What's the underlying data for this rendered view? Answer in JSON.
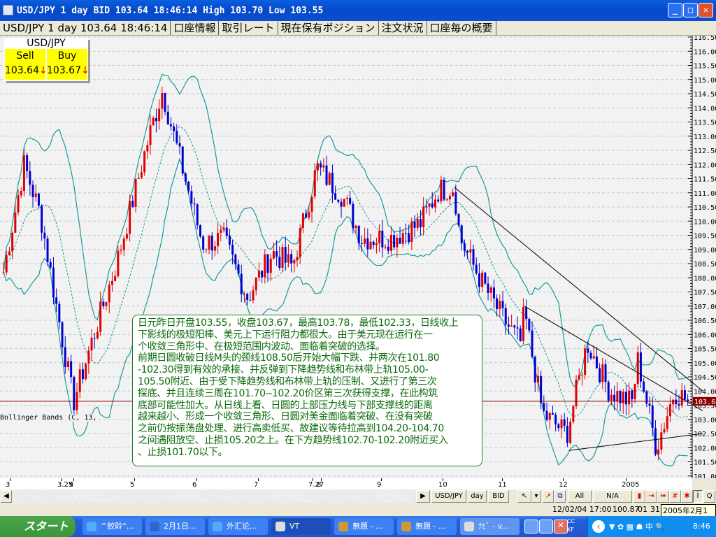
{
  "window": {
    "title": "USD/JPY 1 day BID 103.64 18:46:14 High 103.70 Low 103.55"
  },
  "tabs": [
    "USD/JPY 1 day 103.64 18:46:14",
    "口座情報",
    "取引レート",
    "現在保有ポジション",
    "注文状況",
    "口座毎の概要"
  ],
  "quote": {
    "symbol": "USD/JPY",
    "sell_label": "Sell",
    "buy_label": "Buy",
    "sell": "103.64",
    "buy": "103.67",
    "sell_arrow": "↓",
    "buy_arrow": "↓"
  },
  "indicator_label": "Bollinger Bands (C, 13,",
  "note_lines": [
    "日元昨日开盘103.55，收盘103.67，最高103.78，最低102.33，日线收上",
    "下影线的极短阳棒、美元上下运行阻力都很大。由于美元现在运行在一",
    "个收敛三角形中、在极短范围内波动、面临着突破的选择。",
    "前期日圆收破日线M头的颈线108.50后开始大幅下跌、并两次在101.80",
    "-102.30得到有效的承接、并反弹到下降趋势线和布林带上轨105.00-",
    "105.50附近、由于受下降趋势线和布林带上轨的压制、又进行了第三次",
    "探底、并且连续三周在101.70--102.20价区第三次获得支撑，在此构筑",
    "底部可能性加大。从日线上看、日圆的上部压力线与下部支撑线的距离",
    "越来越小、形成一个收敛三角形、日圆对美金面临着突破、在没有突破",
    "之前仍按振荡盘处理、进行高卖低买、故建议等待拉高到104.20-104.70",
    "之间遇阻放空、止损105.20之上。在下方趋势线102.70-102.20附近买入",
    "、止损101.70以下。"
  ],
  "chart_data": {
    "type": "candlestick",
    "symbol": "USD/JPY",
    "timeframe": "1 day",
    "ylim": [
      101.0,
      116.5
    ],
    "y_ticks": [
      "116.50",
      "116.00",
      "115.50",
      "115.00",
      "114.50",
      "114.00",
      "113.50",
      "113.00",
      "112.50",
      "112.00",
      "111.50",
      "111.00",
      "110.50",
      "110.00",
      "109.50",
      "109.00",
      "108.50",
      "108.00",
      "107.50",
      "107.00",
      "106.50",
      "106.00",
      "105.50",
      "105.00",
      "104.50",
      "104.00",
      "103.50",
      "103.00",
      "102.50",
      "102.00",
      "101.50",
      "101.00"
    ],
    "x_ticks": [
      "3",
      "3.25",
      "4",
      "5",
      "6",
      "7",
      "7.27",
      "8",
      "9",
      "10",
      "11",
      "12",
      "2005"
    ],
    "current_price": "103.64",
    "grid": true,
    "price_path": [
      [
        "2004-02-17",
        108.2
      ],
      [
        "2004-03-08",
        112.0
      ],
      [
        "2004-03-16",
        110.2
      ],
      [
        "2004-04-01",
        103.6
      ],
      [
        "2004-04-09",
        105.5
      ],
      [
        "2004-04-23",
        108.7
      ],
      [
        "2004-05-08",
        112.9
      ],
      [
        "2004-05-15",
        114.6
      ],
      [
        "2004-05-23",
        112.4
      ],
      [
        "2004-06-04",
        109.2
      ],
      [
        "2004-06-14",
        109.4
      ],
      [
        "2004-06-26",
        107.3
      ],
      [
        "2004-07-08",
        108.9
      ],
      [
        "2004-07-18",
        108.4
      ],
      [
        "2004-07-30",
        111.9
      ],
      [
        "2004-08-12",
        110.9
      ],
      [
        "2004-08-22",
        109.4
      ],
      [
        "2004-09-06",
        109.4
      ],
      [
        "2004-09-20",
        109.9
      ],
      [
        "2004-09-29",
        111.1
      ],
      [
        "2004-10-07",
        111.2
      ],
      [
        "2004-10-10",
        109.4
      ],
      [
        "2004-10-21",
        107.9
      ],
      [
        "2004-11-02",
        106.5
      ],
      [
        "2004-11-10",
        105.7
      ],
      [
        "2004-11-12",
        106.8
      ],
      [
        "2004-11-21",
        103.2
      ],
      [
        "2004-12-03",
        102.5
      ],
      [
        "2004-12-13",
        105.7
      ],
      [
        "2004-12-24",
        104.0
      ],
      [
        "2005-01-04",
        103.6
      ],
      [
        "2005-01-07",
        105.1
      ],
      [
        "2005-01-16",
        102.0
      ],
      [
        "2005-01-25",
        104.0
      ],
      [
        "2005-02-01",
        103.64
      ]
    ],
    "bollinger": {
      "period": 13,
      "deviations": 2
    },
    "trendlines": [
      {
        "from": [
          "2004-10-07",
          111.2
        ],
        "to": [
          "2005-02-08",
          104.0
        ]
      },
      {
        "from": [
          "2004-11-12",
          107.0
        ],
        "to": [
          "2005-02-08",
          103.3
        ]
      },
      {
        "from": [
          "2004-12-04",
          101.9
        ],
        "to": [
          "2005-02-08",
          102.5
        ]
      }
    ]
  },
  "toolbar": {
    "symbol": "USD/JPY",
    "period": "day",
    "price_type": "BID",
    "all": "All",
    "na": "N/A",
    "q": "Q"
  },
  "status": {
    "datetime": "12/02/04 17:00",
    "price": "100.87",
    "field1": "01",
    "field2": "31",
    "date": "2005年2月1日"
  },
  "taskbar": {
    "start": "スタート",
    "items": [
      "^餃聆°...",
      "2月1日...",
      "外汇论...",
      "VT",
      "無題 - ...",
      "無題 - ...",
      "ﾅﾋﾞ - v..."
    ],
    "tray_cc": "CC",
    "tray_kf": "KF",
    "clock": "8:46"
  },
  "colors": {
    "up": "#e00000",
    "down": "#0000d0",
    "band": "#1a9a9a",
    "note_text": "#0a6a0a",
    "price_line": "#8b0000"
  }
}
